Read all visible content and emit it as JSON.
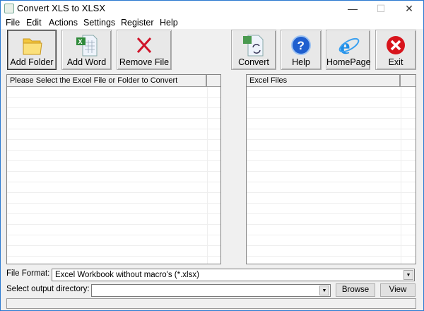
{
  "window": {
    "title": "Convert XLS to XLSX",
    "minimize": "—",
    "maximize": "☐",
    "close": "✕"
  },
  "menu": [
    "File",
    "Edit",
    "Actions",
    "Settings",
    "Register",
    "Help"
  ],
  "toolbar": {
    "add_folder": "Add Folder",
    "add_word": "Add Word",
    "remove_file": "Remove File",
    "convert": "Convert",
    "help": "Help",
    "homepage": "HomePage",
    "exit": "Exit"
  },
  "left_list": {
    "header": "Please Select the Excel File or Folder to Convert"
  },
  "right_list": {
    "header": "Excel Files"
  },
  "bottom": {
    "file_format_label": "File Format:",
    "file_format_value": "Excel Workbook without macro's (*.xlsx)",
    "output_label": "Select  output directory:",
    "output_value": "",
    "browse": "Browse",
    "view": "View"
  }
}
